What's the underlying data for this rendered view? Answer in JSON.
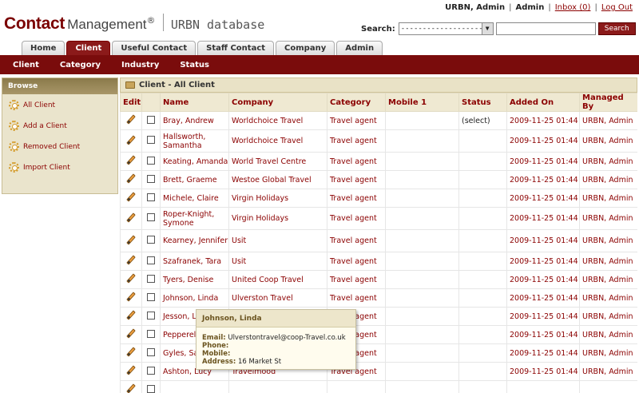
{
  "header": {
    "logo_main": "Contact",
    "logo_sub": "Management",
    "logo_reg": "®",
    "database": "URBN database",
    "user": "URBN, Admin",
    "role": "Admin",
    "inbox": "Inbox (0)",
    "logout": "Log Out",
    "search_label": "Search:",
    "search_select_value": "-------------------------",
    "search_button": "Search"
  },
  "tabs": [
    {
      "label": "Home"
    },
    {
      "label": "Client"
    },
    {
      "label": "Useful Contact"
    },
    {
      "label": "Staff Contact"
    },
    {
      "label": "Company"
    },
    {
      "label": "Admin"
    }
  ],
  "subnav": [
    {
      "label": "Client"
    },
    {
      "label": "Category"
    },
    {
      "label": "Industry"
    },
    {
      "label": "Status"
    }
  ],
  "sidebar": {
    "header": "Browse",
    "items": [
      {
        "label": "All Client",
        "icon": "gear-icon"
      },
      {
        "label": "Add a Client",
        "icon": "gear-icon"
      },
      {
        "label": "Removed Client",
        "icon": "gear-icon"
      },
      {
        "label": "Import Client",
        "icon": "gear-icon"
      }
    ]
  },
  "panel": {
    "title": "Client - All Client",
    "columns": [
      "Edit",
      "",
      "Name",
      "Company",
      "Category",
      "Mobile 1",
      "Status",
      "Added On",
      "Managed By"
    ],
    "rows": [
      {
        "name": "Bray, Andrew",
        "company": "Worldchoice Travel",
        "category": "Travel agent",
        "mobile": "",
        "status": "(select)",
        "added": "2009-11-25 01:44",
        "managed": "URBN, Admin"
      },
      {
        "name": "Hallsworth, Samantha",
        "company": "Worldchoice Travel",
        "category": "Travel agent",
        "mobile": "",
        "status": "",
        "added": "2009-11-25 01:44",
        "managed": "URBN, Admin"
      },
      {
        "name": "Keating, Amanda",
        "company": "World Travel Centre",
        "category": "Travel agent",
        "mobile": "",
        "status": "",
        "added": "2009-11-25 01:44",
        "managed": "URBN, Admin"
      },
      {
        "name": "Brett, Graeme",
        "company": "Westoe Global Travel",
        "category": "Travel agent",
        "mobile": "",
        "status": "",
        "added": "2009-11-25 01:44",
        "managed": "URBN, Admin"
      },
      {
        "name": "Michele, Claire",
        "company": "Virgin Holidays",
        "category": "Travel agent",
        "mobile": "",
        "status": "",
        "added": "2009-11-25 01:44",
        "managed": "URBN, Admin"
      },
      {
        "name": "Roper-Knight, Symone",
        "company": "Virgin Holidays",
        "category": "Travel agent",
        "mobile": "",
        "status": "",
        "added": "2009-11-25 01:44",
        "managed": "URBN, Admin"
      },
      {
        "name": "Kearney, Jennifer",
        "company": "Usit",
        "category": "Travel agent",
        "mobile": "",
        "status": "",
        "added": "2009-11-25 01:44",
        "managed": "URBN, Admin"
      },
      {
        "name": "Szafranek, Tara",
        "company": "Usit",
        "category": "Travel agent",
        "mobile": "",
        "status": "",
        "added": "2009-11-25 01:44",
        "managed": "URBN, Admin"
      },
      {
        "name": "Tyers, Denise",
        "company": "United Coop Travel",
        "category": "Travel agent",
        "mobile": "",
        "status": "",
        "added": "2009-11-25 01:44",
        "managed": "URBN, Admin"
      },
      {
        "name": "Johnson, Linda",
        "company": "Ulverston Travel",
        "category": "Travel agent",
        "mobile": "",
        "status": "",
        "added": "2009-11-25 01:44",
        "managed": "URBN, Admin"
      },
      {
        "name": "Jesson, L",
        "company": "",
        "category": "Travel agent",
        "mobile": "",
        "status": "",
        "added": "2009-11-25 01:44",
        "managed": "URBN, Admin"
      },
      {
        "name": "Pepperell",
        "company": "",
        "category": "Travel agent",
        "mobile": "",
        "status": "",
        "added": "2009-11-25 01:44",
        "managed": "URBN, Admin"
      },
      {
        "name": "Gyles, Sa",
        "company": "",
        "category": "Travel agent",
        "mobile": "",
        "status": "",
        "added": "2009-11-25 01:44",
        "managed": "URBN, Admin"
      },
      {
        "name": "Ashton, Lucy",
        "company": "Travelmood",
        "category": "Travel agent",
        "mobile": "",
        "status": "",
        "added": "2009-11-25 01:44",
        "managed": "URBN, Admin"
      },
      {
        "name": "",
        "company": "",
        "category": "",
        "mobile": "",
        "status": "",
        "added": "",
        "managed": ""
      }
    ]
  },
  "tooltip": {
    "title": "Johnson, Linda",
    "email_label": "Email:",
    "email": "Ulverstontravel@coop-Travel.co.uk",
    "phone_label": "Phone:",
    "phone": "",
    "mobile_label": "Mobile:",
    "mobile": "",
    "address_label": "Address:",
    "address": "16 Market St"
  }
}
